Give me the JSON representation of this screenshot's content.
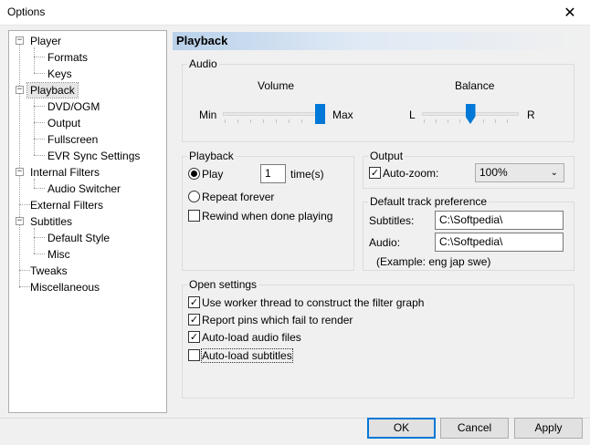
{
  "window": {
    "title": "Options",
    "close_glyph": "✕"
  },
  "tree": {
    "items": [
      {
        "label": "Player",
        "level": 0,
        "expander": "−"
      },
      {
        "label": "Formats",
        "level": 1
      },
      {
        "label": "Keys",
        "level": 1
      },
      {
        "label": "Playback",
        "level": 0,
        "expander": "−",
        "selected": true
      },
      {
        "label": "DVD/OGM",
        "level": 1
      },
      {
        "label": "Output",
        "level": 1
      },
      {
        "label": "Fullscreen",
        "level": 1
      },
      {
        "label": "EVR Sync Settings",
        "level": 1
      },
      {
        "label": "Internal Filters",
        "level": 0,
        "expander": "−"
      },
      {
        "label": "Audio Switcher",
        "level": 1
      },
      {
        "label": "External Filters",
        "level": 0
      },
      {
        "label": "Subtitles",
        "level": 0,
        "expander": "−"
      },
      {
        "label": "Default Style",
        "level": 1
      },
      {
        "label": "Misc",
        "level": 1
      },
      {
        "label": "Tweaks",
        "level": 0
      },
      {
        "label": "Miscellaneous",
        "level": 0
      }
    ]
  },
  "page": {
    "title": "Playback"
  },
  "audio": {
    "label": "Audio",
    "volume": {
      "title": "Volume",
      "min_label": "Min",
      "max_label": "Max",
      "value_fraction": 1.0
    },
    "balance": {
      "title": "Balance",
      "left_label": "L",
      "right_label": "R",
      "value_fraction": 0.5
    }
  },
  "playback": {
    "label": "Playback",
    "play_label": "Play",
    "play_count": "1",
    "times_label": "time(s)",
    "repeat_label": "Repeat forever",
    "rewind_label": "Rewind when done playing",
    "play_selected": true,
    "rewind_checked": false
  },
  "output": {
    "label": "Output",
    "autozoom_label": "Auto-zoom:",
    "autozoom_checked": true,
    "zoom_value": "100%",
    "chevron": "⌄"
  },
  "track_pref": {
    "label": "Default track preference",
    "subtitles_label": "Subtitles:",
    "subtitles_value": "C:\\Softpedia\\",
    "audio_label": "Audio:",
    "audio_value": "C:\\Softpedia\\",
    "example": "(Example: eng jap swe)"
  },
  "open_settings": {
    "label": "Open settings",
    "items": [
      {
        "label": "Use worker thread to construct the filter graph",
        "checked": true
      },
      {
        "label": "Report pins which fail to render",
        "checked": true
      },
      {
        "label": "Auto-load audio files",
        "checked": true
      },
      {
        "label": "Auto-load subtitles",
        "checked": false
      }
    ]
  },
  "buttons": {
    "ok": "OK",
    "cancel": "Cancel",
    "apply": "Apply"
  },
  "check_glyph": "✓",
  "accent_color": "#0078d7"
}
